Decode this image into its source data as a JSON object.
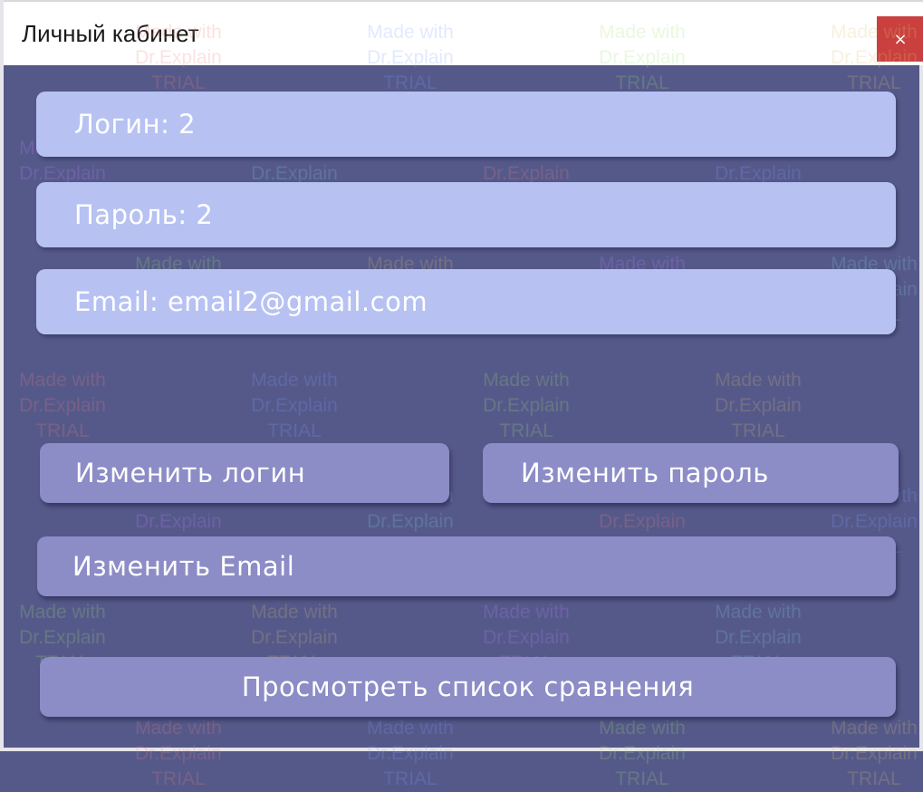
{
  "window": {
    "title": "Личный кабинет",
    "close_symbol": "×"
  },
  "fields": {
    "login": "Логин: 2",
    "password": "Пароль: 2",
    "email": "Email: email2@gmail.com"
  },
  "buttons": {
    "change_login": "Изменить логин",
    "change_password": "Изменить пароль",
    "change_email": "Изменить Email",
    "view_comparison": "Просмотреть список сравнения"
  },
  "watermark": {
    "line1": "Made with",
    "line2": "Dr.Explain",
    "line3": "TRIAL"
  },
  "colors": {
    "background": "#55598a",
    "field": "#b7c2f2",
    "button": "#8c8cc6",
    "close": "#c9403f"
  }
}
